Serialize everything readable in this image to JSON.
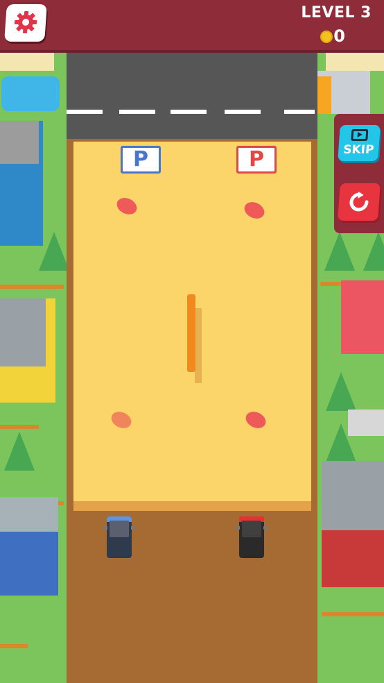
{
  "hud": {
    "level_label": "LEVEL 3",
    "coins": "0",
    "settings_icon": "gear-icon",
    "coin_icon": "coin-icon"
  },
  "controls": {
    "skip_label": "SKIP",
    "skip_icon": "video-play-icon",
    "restart_icon": "restart-icon"
  },
  "parking": {
    "blue_spot_label": "P",
    "red_spot_label": "P"
  },
  "colors": {
    "topbar": "#8e2c39",
    "lot": "#fbd46a",
    "blue_car": "#4a76c9",
    "red_car": "#e04848",
    "skip_button": "#23c5e8",
    "restart_button": "#e8343f"
  }
}
